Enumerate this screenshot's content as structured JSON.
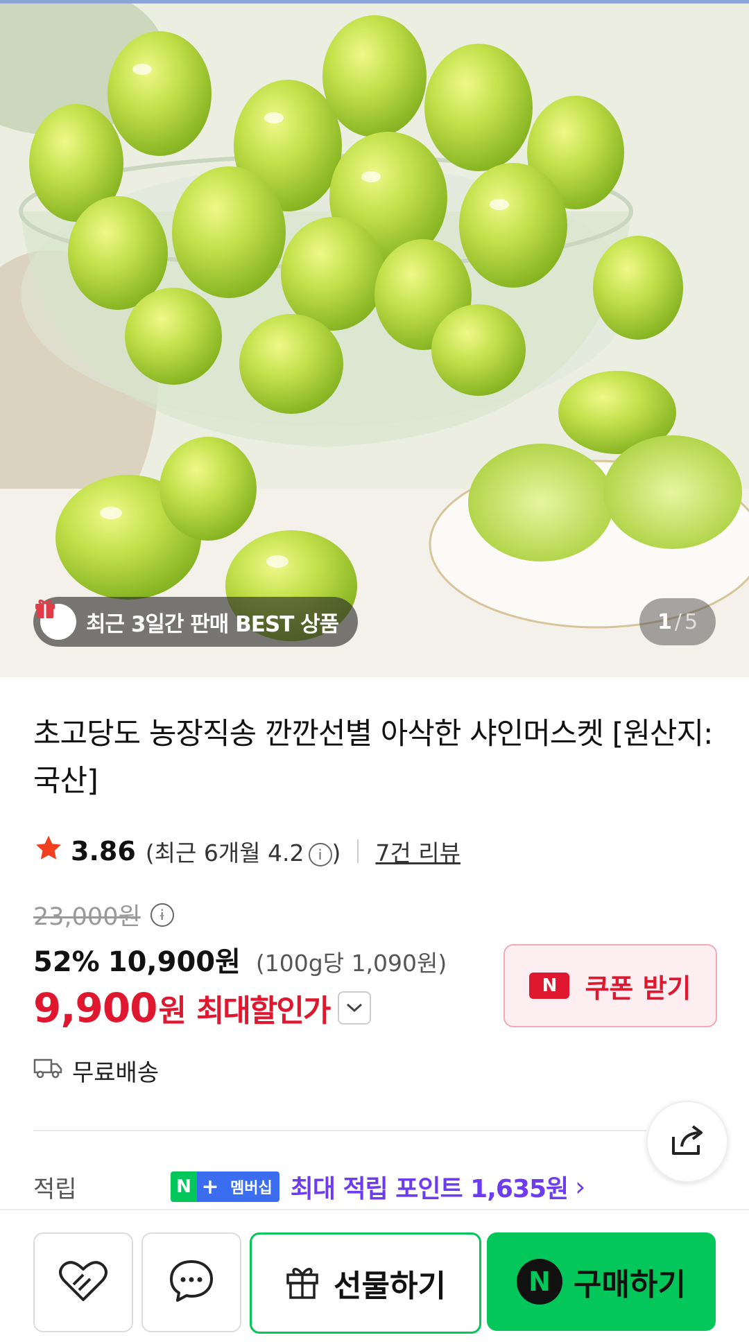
{
  "hero": {
    "image_alt": "shine muscat grapes in glass bowl",
    "badge_text": "최근 3일간 판매 BEST 상품",
    "pager_current": "1",
    "pager_sep": "/",
    "pager_total": "5"
  },
  "product": {
    "title": "초고당도 농장직송 깐깐선별 아삭한 샤인머스켓 [원산지:국산]",
    "rating": "3.86",
    "recent_prefix": "(최근 6개월 4.2",
    "recent_suffix": ")",
    "review_link": "7건 리뷰"
  },
  "price": {
    "original": "23,000원",
    "discount_rate": "52%",
    "sale_price": "10,900원",
    "unit_price": "(100g당 1,090원)",
    "max_price": "9,900",
    "max_won": "원",
    "max_label": "최대할인가"
  },
  "coupon": {
    "label": "쿠폰 받기",
    "icon_text": "N"
  },
  "shipping": {
    "label": "무료배송"
  },
  "points": {
    "label": "적립",
    "badge_n": "N",
    "badge_plus": "+",
    "badge_member": "멤버십",
    "text": "최대 적립 포인트 1,635원",
    "arrow": "›"
  },
  "bottom_bar": {
    "gift_label": "선물하기",
    "buy_label": "구매하기",
    "buy_icon": "N"
  },
  "colors": {
    "accent_green": "#03c75a",
    "sale_red": "#e0182f",
    "points_purple": "#6d3cf0"
  },
  "icons": [
    "gift-box-icon",
    "info-icon",
    "star-icon",
    "chevron-down-icon",
    "truck-icon",
    "share-icon",
    "heart-icon",
    "chat-icon",
    "present-icon",
    "naver-n-icon"
  ]
}
